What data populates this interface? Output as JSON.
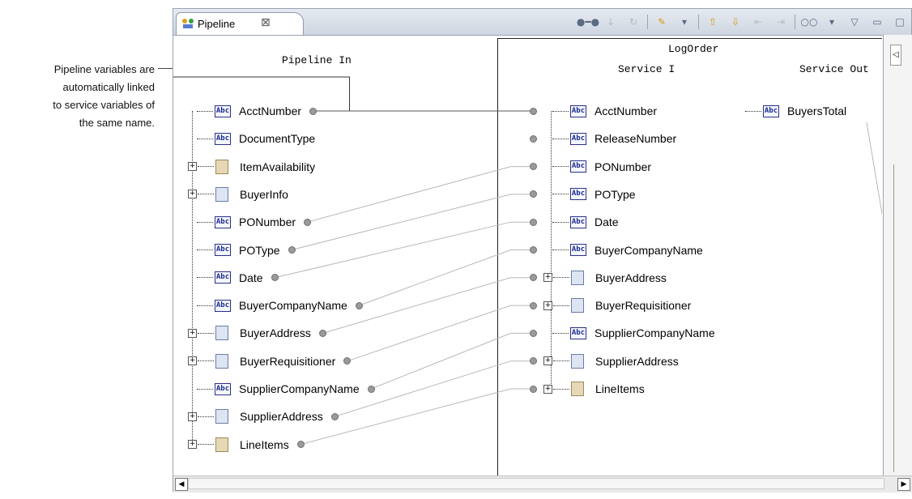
{
  "annotation": {
    "lines": [
      "Pipeline variables are",
      "automatically linked",
      "to service variables of",
      "the same name."
    ]
  },
  "window": {
    "tab": {
      "label": "Pipeline",
      "close": "⊠"
    },
    "toolbar_icons": [
      "link-icon",
      "map-delete-icon",
      "restore-icon",
      "set-value-icon",
      "dropdown-icon",
      "shift-up-icon",
      "shift-down-icon",
      "shift-left-icon",
      "shift-right-icon",
      "layout-icon",
      "dropdown-icon",
      "view-menu-icon",
      "minimize-icon",
      "maximize-icon"
    ]
  },
  "pipeline_in": {
    "header": "Pipeline In",
    "items": [
      {
        "label": "AcctNumber",
        "type": "string",
        "expand": false,
        "linked": true
      },
      {
        "label": "DocumentType",
        "type": "string",
        "expand": false,
        "linked": false
      },
      {
        "label": "ItemAvailability",
        "type": "doclist",
        "expand": true,
        "linked": false
      },
      {
        "label": "BuyerInfo",
        "type": "doc",
        "expand": true,
        "linked": false
      },
      {
        "label": "PONumber",
        "type": "string",
        "expand": false,
        "linked": true
      },
      {
        "label": "POType",
        "type": "string",
        "expand": false,
        "linked": true
      },
      {
        "label": "Date",
        "type": "string",
        "expand": false,
        "linked": true
      },
      {
        "label": "BuyerCompanyName",
        "type": "string",
        "expand": false,
        "linked": true
      },
      {
        "label": "BuyerAddress",
        "type": "doc",
        "expand": true,
        "linked": true
      },
      {
        "label": "BuyerRequisitioner",
        "type": "doc",
        "expand": true,
        "linked": true
      },
      {
        "label": "SupplierCompanyName",
        "type": "string",
        "expand": false,
        "linked": true
      },
      {
        "label": "SupplierAddress",
        "type": "doc",
        "expand": true,
        "linked": true
      },
      {
        "label": "LineItems",
        "type": "doclist",
        "expand": true,
        "linked": true
      }
    ]
  },
  "service": {
    "name": "LogOrder",
    "in_header": "Service I",
    "out_header": "Service Out",
    "in_items": [
      {
        "label": "AcctNumber",
        "type": "string",
        "expand": false
      },
      {
        "label": "ReleaseNumber",
        "type": "string",
        "expand": false
      },
      {
        "label": "PONumber",
        "type": "string",
        "expand": false
      },
      {
        "label": "POType",
        "type": "string",
        "expand": false
      },
      {
        "label": "Date",
        "type": "string",
        "expand": false
      },
      {
        "label": "BuyerCompanyName",
        "type": "string",
        "expand": false
      },
      {
        "label": "BuyerAddress",
        "type": "doc",
        "expand": true
      },
      {
        "label": "BuyerRequisitioner",
        "type": "doc",
        "expand": true
      },
      {
        "label": "SupplierCompanyName",
        "type": "string",
        "expand": false
      },
      {
        "label": "SupplierAddress",
        "type": "doc",
        "expand": true
      },
      {
        "label": "LineItems",
        "type": "doclist",
        "expand": true
      }
    ],
    "out_items": [
      {
        "label": "BuyersTotal",
        "type": "string"
      }
    ]
  },
  "links": [
    [
      0,
      0
    ],
    [
      4,
      2
    ],
    [
      5,
      3
    ],
    [
      6,
      4
    ],
    [
      7,
      5
    ],
    [
      8,
      6
    ],
    [
      9,
      7
    ],
    [
      10,
      8
    ],
    [
      11,
      9
    ],
    [
      12,
      10
    ]
  ]
}
